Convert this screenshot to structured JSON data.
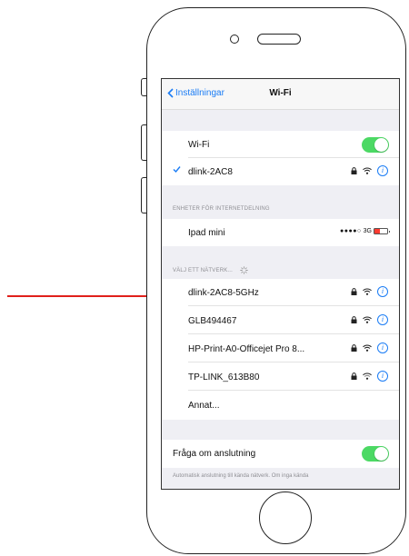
{
  "nav": {
    "back_label": "Inställningar",
    "title": "Wi-Fi"
  },
  "wifi_toggle": {
    "label": "Wi-Fi",
    "on": true
  },
  "connected_network": {
    "name": "dlink-2AC8",
    "locked": true
  },
  "hotspot_section": {
    "header": "ENHETER FÖR INTERNETDELNING",
    "device": {
      "name": "Ipad mini",
      "signal_dots": "●●●●○",
      "network_type": "3G"
    }
  },
  "networks_section": {
    "header": "VÄLJ ETT NÄTVERK...",
    "networks": [
      {
        "name": "dlink-2AC8-5GHz",
        "locked": true
      },
      {
        "name": "GLB494467",
        "locked": true
      },
      {
        "name": "HP-Print-A0-Officejet Pro 8...",
        "locked": false
      },
      {
        "name": "TP-LINK_613B80",
        "locked": true
      }
    ],
    "other_label": "Annat..."
  },
  "ask_to_join": {
    "label": "Fråga om anslutning",
    "on": true
  },
  "footer": {
    "text": "Automatisk anslutning till kända nätverk. Om inga kända"
  },
  "colors": {
    "accent": "#1a7cf5",
    "toggle_on": "#4cd964",
    "arrow": "#e0201b",
    "group_bg": "#efeff4"
  },
  "icons": [
    "chevron-left-icon",
    "checkmark-icon",
    "lock-icon",
    "wifi-icon",
    "info-icon",
    "spinner-icon",
    "battery-icon"
  ]
}
